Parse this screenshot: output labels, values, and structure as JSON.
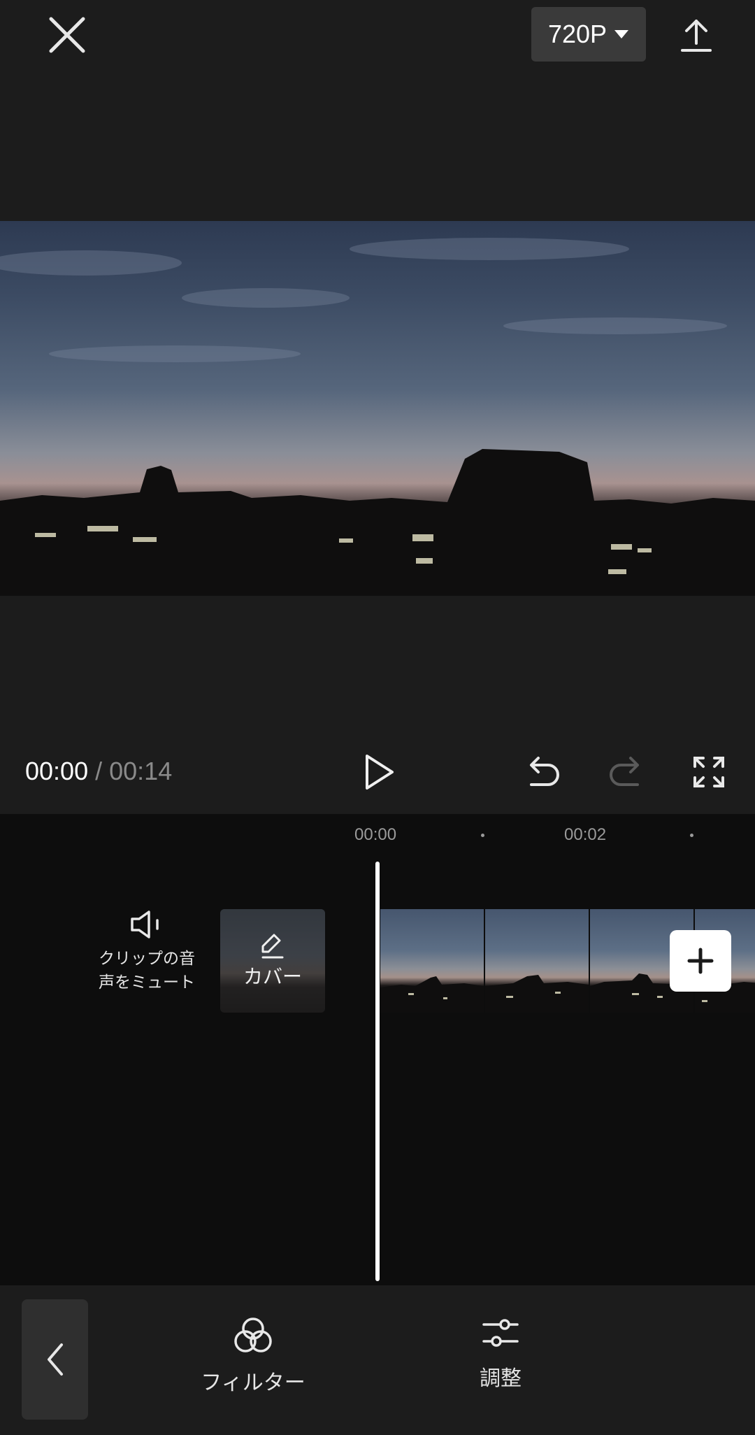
{
  "header": {
    "close_icon": "close-icon",
    "resolution_label": "720P",
    "dropdown_icon": "caret-down-icon",
    "export_icon": "upload-icon"
  },
  "player": {
    "current_time": "00:00",
    "separator": "/",
    "total_time": "00:14",
    "play_icon": "play-icon",
    "undo_icon": "undo-icon",
    "redo_icon": "redo-icon",
    "fullscreen_icon": "fullscreen-icon"
  },
  "timeline": {
    "ruler_labels": [
      "00:00",
      "00:02"
    ],
    "mute_label_line1": "クリップの音",
    "mute_label_line2": "声をミュート",
    "cover_label": "カバー",
    "add_icon": "plus-icon"
  },
  "toolbar": {
    "back_icon": "chevron-left-icon",
    "filter_label": "フィルター",
    "adjust_label": "調整"
  },
  "colors": {
    "background": "#1c1c1c",
    "timeline_background": "#0d0d0d",
    "button_background": "#3a3a3a",
    "text_primary": "#ffffff",
    "text_secondary": "#8a8a8a"
  }
}
